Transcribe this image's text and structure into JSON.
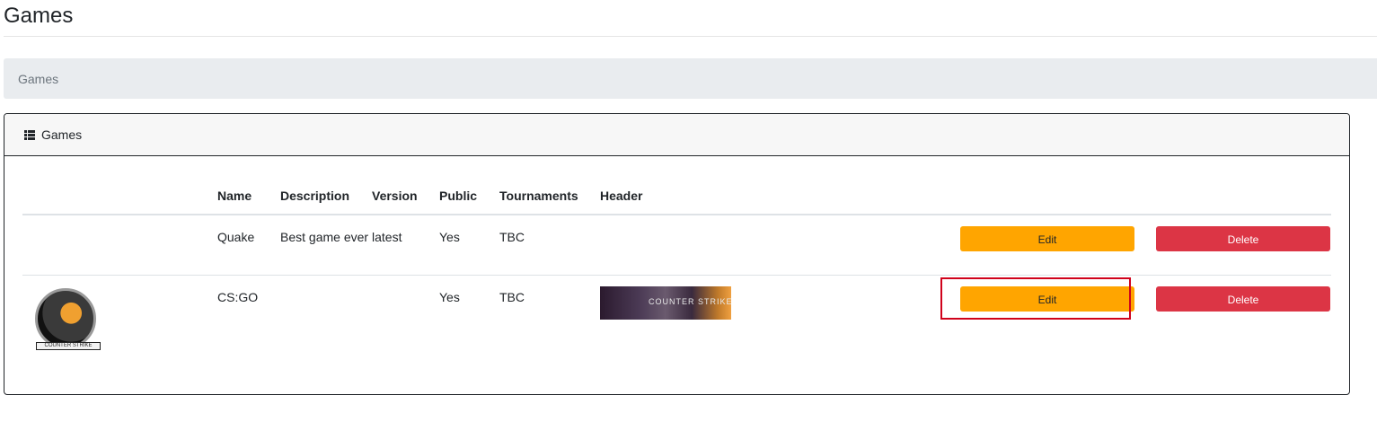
{
  "page": {
    "title": "Games"
  },
  "breadcrumb": {
    "current": "Games"
  },
  "card": {
    "header_icon": "list-icon",
    "header_title": "Games"
  },
  "table": {
    "columns": [
      "",
      "Name",
      "Description",
      "Version",
      "Public",
      "Tournaments",
      "Header",
      "",
      ""
    ],
    "rows": [
      {
        "logo": "",
        "name": "Quake",
        "description": "Best game ever",
        "version": "latest",
        "public": "Yes",
        "tournaments": "TBC",
        "header": "",
        "edit_label": "Edit",
        "delete_label": "Delete"
      },
      {
        "logo": "counter-strike-logo",
        "logo_text": "COUNTER STRIKE",
        "name": "CS:GO",
        "description": "",
        "version": "",
        "public": "Yes",
        "tournaments": "TBC",
        "header": "counter-strike-banner",
        "header_text": "COUNTER STRIKE",
        "edit_label": "Edit",
        "delete_label": "Delete"
      }
    ]
  },
  "colors": {
    "edit_button": "#ffa500",
    "delete_button": "#dc3545",
    "breadcrumb_bg": "#e9ecef",
    "focus_outline": "#d0021b"
  }
}
